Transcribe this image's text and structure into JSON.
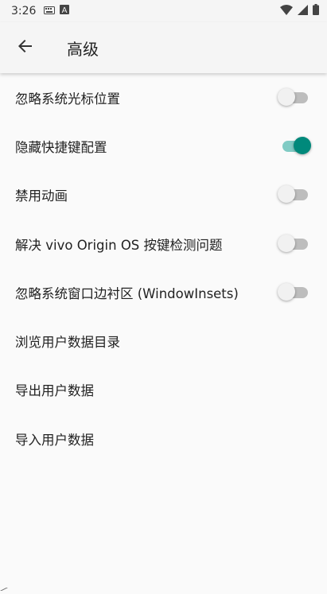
{
  "status_bar": {
    "time": "3:26",
    "icons_left": [
      "keyboard-icon",
      "a-icon"
    ],
    "icons_right": [
      "wifi-icon",
      "signal-icon",
      "battery-icon"
    ]
  },
  "toolbar": {
    "back_icon": "arrow-left-icon",
    "title": "高级"
  },
  "colors": {
    "accent": "#00897b",
    "accent_track": "#80cbc4",
    "off_track": "#bdbdbd",
    "off_thumb": "#f1f1f1"
  },
  "settings": [
    {
      "label": "忽略系统光标位置",
      "has_switch": true,
      "checked": false
    },
    {
      "label": "隐藏快捷键配置",
      "has_switch": true,
      "checked": true
    },
    {
      "label": "禁用动画",
      "has_switch": true,
      "checked": false
    },
    {
      "label": "解决 vivo Origin OS 按键检测问题",
      "has_switch": true,
      "checked": false
    },
    {
      "label": "忽略系统窗口边衬区 (WindowInsets)",
      "has_switch": true,
      "checked": false
    },
    {
      "label": "浏览用户数据目录",
      "has_switch": false
    },
    {
      "label": "导出用户数据",
      "has_switch": false
    },
    {
      "label": "导入用户数据",
      "has_switch": false
    }
  ]
}
